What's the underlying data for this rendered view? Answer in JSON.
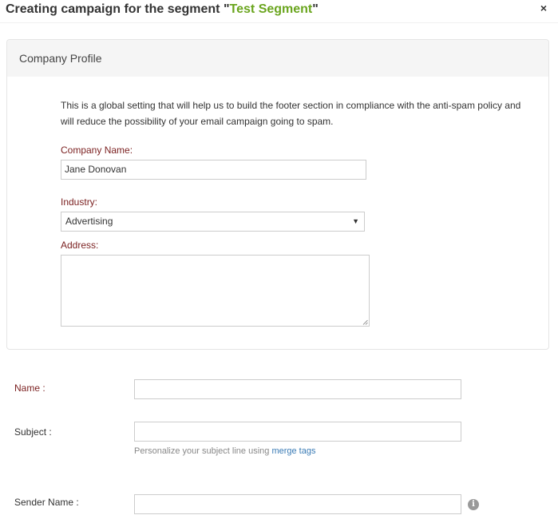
{
  "header": {
    "title_prefix": "Creating campaign for the segment \"",
    "segment_name": "Test Segment",
    "title_suffix": "\"",
    "close_symbol": "×"
  },
  "company_profile": {
    "title": "Company Profile",
    "description": "This is a global setting that will help us to build the footer section in compliance with the anti-spam policy and will reduce the possibility of your email campaign going to spam.",
    "company_name_label": "Company Name:",
    "company_name_value": "Jane Donovan",
    "industry_label": "Industry:",
    "industry_value": "Advertising",
    "address_label": "Address:",
    "address_value": ""
  },
  "campaign_form": {
    "name_label": "Name :",
    "name_value": "",
    "subject_label": "Subject :",
    "subject_value": "",
    "subject_hint_prefix": "Personalize your subject line using ",
    "subject_hint_link": "merge tags",
    "sender_name_label": "Sender Name :",
    "sender_name_value": "",
    "info_icon_glyph": "i"
  },
  "colors": {
    "segment_accent": "#6aa51e",
    "label_color": "#7a1f1f",
    "link_color": "#3a7bb5"
  },
  "icons": {
    "close": "close-icon",
    "dropdown": "chevron-down-icon",
    "info": "info-icon"
  }
}
